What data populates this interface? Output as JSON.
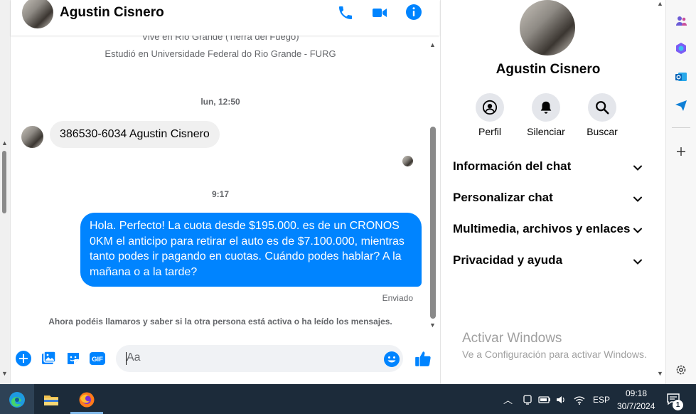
{
  "chat": {
    "contact_name": "Agustin Cisnero",
    "bio_line1": "Vive en Río Grande (Tierra del Fuego)",
    "bio_line2": "Estudió en Universidade Federal do Rio Grande - FURG",
    "timestamp1": "lun, 12:50",
    "contact_message": "386530-6034 Agustin Cisnero",
    "timestamp2": "9:17",
    "outgoing_message": "Hola. Perfecto! La cuota desde $195.000. es de un CRONOS 0KM el anticipo para retirar el auto es de $7.100.000, mientras tanto podes ir pagando en cuotas. Cuándo podes hablar? A la mañana o a la tarde?",
    "sent_status": "Enviado",
    "notice": "Ahora podéis llamaros y saber si la otra persona está activa o ha leído los mensajes.",
    "accent_color": "#0084ff"
  },
  "composer": {
    "placeholder": "Aa",
    "gif_label": "GIF"
  },
  "panel": {
    "name": "Agustin Cisnero",
    "actions": [
      {
        "label": "Perfil",
        "icon": "profile-icon"
      },
      {
        "label": "Silenciar",
        "icon": "bell-icon"
      },
      {
        "label": "Buscar",
        "icon": "search-icon"
      }
    ],
    "sections": [
      "Información del chat",
      "Personalizar chat",
      "Multimedia, archivos y enlaces",
      "Privacidad y ayuda"
    ],
    "watermark_title": "Activar Windows",
    "watermark_sub": "Ve a Configuración para activar Windows."
  },
  "taskbar": {
    "language": "ESP",
    "time": "09:18",
    "date": "30/7/2024",
    "notification_count": "1"
  }
}
